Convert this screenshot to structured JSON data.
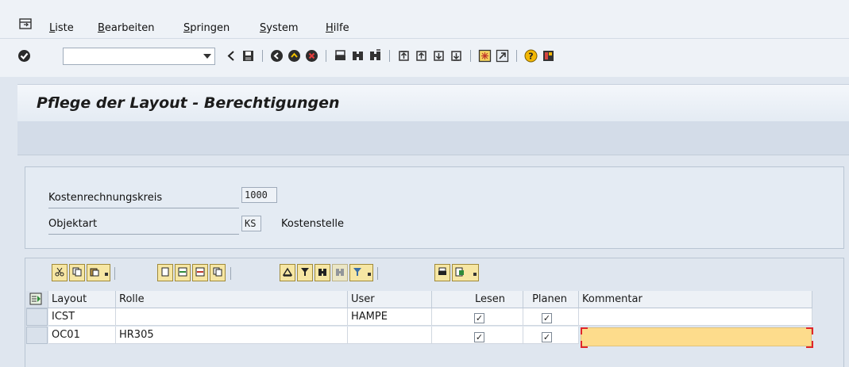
{
  "menu": [
    "Liste",
    "Bearbeiten",
    "Springen",
    "System",
    "Hilfe"
  ],
  "toolbar": {
    "command_value": "",
    "icons": [
      "enter-icon",
      "back-icon",
      "save-icon",
      "back-green-icon",
      "exit-icon",
      "cancel-icon",
      "print-icon",
      "find-icon",
      "find-next-icon",
      "first-page-icon",
      "previous-page-icon",
      "next-page-icon",
      "last-page-icon",
      "new-session-icon",
      "shortcut-icon",
      "help-icon",
      "layout-icon"
    ]
  },
  "title": "Pflege der Layout - Berechtigungen",
  "form": {
    "kostenrechnungskreis_label": "Kostenrechnungskreis",
    "kostenrechnungskreis_value": "1000",
    "objektart_label": "Objektart",
    "objektart_value": "KS",
    "objektart_text": "Kostenstelle"
  },
  "grid": {
    "toolbar_icons": [
      "cut-icon",
      "copy-icon",
      "paste-icon",
      "new-row-icon",
      "insert-row-icon",
      "delete-row-icon",
      "duplicate-row-icon",
      "sort-ascending-icon",
      "filter-icon",
      "find-icon",
      "find-next-icon",
      "set-filter-icon",
      "print-icon",
      "export-icon"
    ],
    "columns": [
      "Layout",
      "Rolle",
      "User",
      "Lesen",
      "Planen",
      "Kommentar"
    ],
    "rows": [
      {
        "layout": "ICST",
        "rolle": "",
        "user": "HAMPE",
        "lesen": true,
        "planen": true,
        "kommentar": ""
      },
      {
        "layout": "OC01",
        "rolle": "HR305",
        "user": "",
        "lesen": true,
        "planen": true,
        "kommentar": ""
      }
    ]
  },
  "colors": {
    "accent_focus": "#fddc8c",
    "toolbar_button": "#f6e6a3",
    "background": "#dfe6ef"
  }
}
